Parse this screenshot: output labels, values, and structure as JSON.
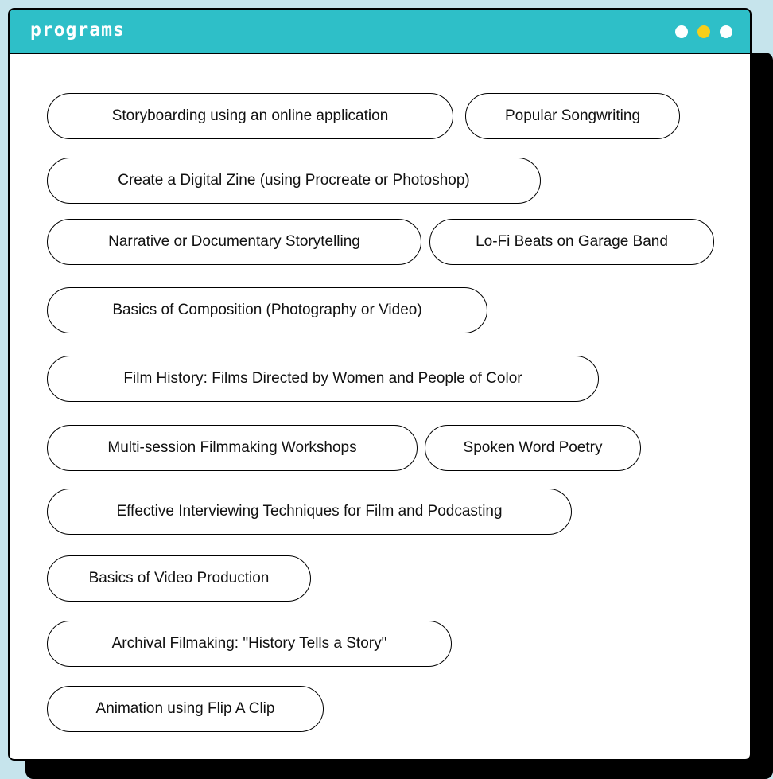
{
  "window": {
    "title": "programs",
    "colors": {
      "background": "#c6e4ec",
      "titlebar": "#2ebfc8",
      "dot_white": "#ffffff",
      "dot_yellow": "#f7cf1a"
    }
  },
  "programs": [
    "Storyboarding using an online application",
    "Popular Songwriting",
    "Create a Digital Zine (using Procreate or Photoshop)",
    "Narrative or Documentary Storytelling",
    "Lo-Fi Beats on Garage Band",
    "Basics of Composition (Photography or Video)",
    "Film History: Films Directed by Women and People of Color",
    "Multi-session Filmmaking Workshops",
    "Spoken Word Poetry",
    "Effective Interviewing Techniques for Film and Podcasting",
    "Basics of Video Production",
    "Archival Filmaking: \"History Tells a Story\"",
    "Animation using Flip A Clip"
  ]
}
